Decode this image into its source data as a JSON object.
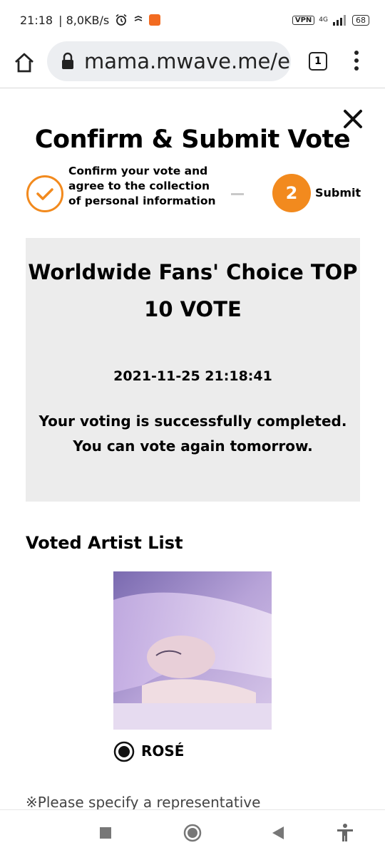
{
  "status_bar": {
    "time": "21:18",
    "speed": "| 8,0KB/s",
    "vpn": "VPN",
    "network": "4G",
    "battery": "68"
  },
  "browser": {
    "url": "mama.mwave.me/en",
    "tab_count": "1"
  },
  "dialog": {
    "title": "Confirm & Submit Vote",
    "step1_label": "Confirm your vote and agree to the collection of personal information",
    "step2_number": "2",
    "step2_label": "Submit"
  },
  "result": {
    "vote_title": "Worldwide Fans' Choice TOP 10 VOTE",
    "timestamp": "2021-11-25 21:18:41",
    "message_line1": "Your voting is successfully completed.",
    "message_line2": "You can vote again tomorrow."
  },
  "voted_artists": {
    "heading": "Voted Artist List",
    "artists": [
      {
        "name": "ROSÉ",
        "selected": true
      }
    ]
  },
  "note": "※Please specify a representative",
  "colors": {
    "accent_orange": "#f28a1e",
    "result_box_bg": "#ececec",
    "url_pill_bg": "#eceef1"
  },
  "icons": {
    "home": "home-icon",
    "lock": "lock-icon",
    "menu": "more-vert-icon",
    "close": "close-icon",
    "check": "check-circle-icon",
    "radio": "radio-selected-icon",
    "nav_recents": "square-icon",
    "nav_home": "circle-icon",
    "nav_back": "triangle-back-icon",
    "nav_accessibility": "accessibility-icon"
  }
}
